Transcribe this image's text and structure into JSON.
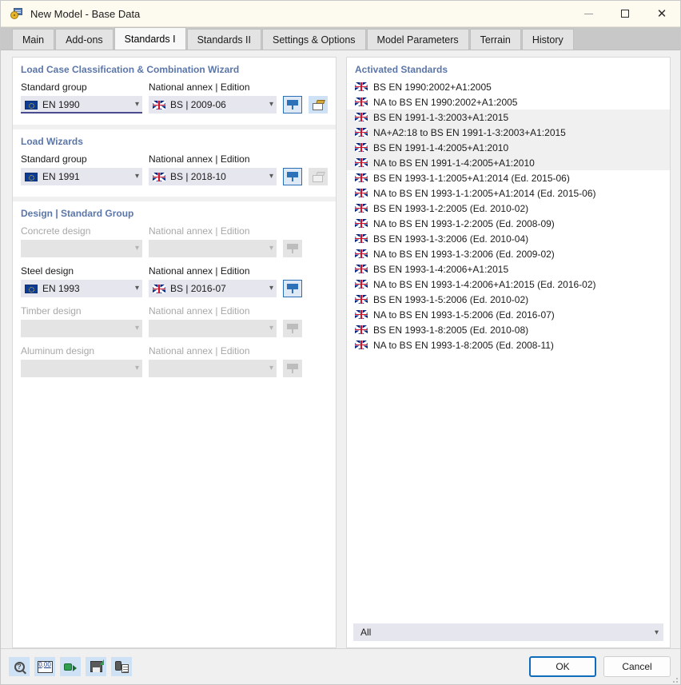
{
  "window": {
    "title": "New Model - Base Data",
    "icon": "model-base-data-icon",
    "minimize": "minimize-icon",
    "maximize": "maximize-icon",
    "close": "close-icon"
  },
  "tabs": [
    {
      "label": "Main",
      "active": false
    },
    {
      "label": "Add-ons",
      "active": false
    },
    {
      "label": "Standards I",
      "active": true
    },
    {
      "label": "Standards II",
      "active": false
    },
    {
      "label": "Settings & Options",
      "active": false
    },
    {
      "label": "Model Parameters",
      "active": false
    },
    {
      "label": "Terrain",
      "active": false
    },
    {
      "label": "History",
      "active": false
    }
  ],
  "groups": [
    {
      "title": "Load Case Classification & Combination Wizard",
      "standard_label": "Standard group",
      "standard_value": "EN 1990",
      "standard_flag": "flag-eu",
      "standard_disabled": false,
      "standard_focused": true,
      "annex_label": "National annex | Edition",
      "annex_value": "BS | 2009-06",
      "annex_flag": "flag-uk",
      "annex_disabled": false,
      "filter_enabled": true,
      "box_enabled": true
    },
    {
      "title": "Load Wizards",
      "standard_label": "Standard group",
      "standard_value": "EN 1991",
      "standard_flag": "flag-eu",
      "standard_disabled": false,
      "standard_focused": false,
      "annex_label": "National annex | Edition",
      "annex_value": "BS | 2018-10",
      "annex_flag": "flag-uk",
      "annex_disabled": false,
      "filter_enabled": true,
      "box_enabled": false
    }
  ],
  "design_group": {
    "title": "Design | Standard Group",
    "rows": [
      {
        "label": "Concrete design",
        "value": "",
        "flag": "none",
        "disabled": true,
        "annex_label": "National annex | Edition",
        "annex_value": "",
        "annex_flag": "none",
        "annex_disabled": true,
        "filter_enabled": false
      },
      {
        "label": "Steel design",
        "value": "EN 1993",
        "flag": "flag-eu",
        "disabled": false,
        "annex_label": "National annex | Edition",
        "annex_value": "BS | 2016-07",
        "annex_flag": "flag-uk",
        "annex_disabled": false,
        "filter_enabled": true
      },
      {
        "label": "Timber design",
        "value": "",
        "flag": "none",
        "disabled": true,
        "annex_label": "National annex | Edition",
        "annex_value": "",
        "annex_flag": "none",
        "annex_disabled": true,
        "filter_enabled": false
      },
      {
        "label": "Aluminum design",
        "value": "",
        "flag": "none",
        "disabled": true,
        "annex_label": "National annex | Edition",
        "annex_value": "",
        "annex_flag": "none",
        "annex_disabled": true,
        "filter_enabled": false
      }
    ]
  },
  "activated_standards": {
    "title": "Activated Standards",
    "items": [
      {
        "label": "BS EN 1990:2002+A1:2005",
        "flag": "flag-uk",
        "highlighted": false
      },
      {
        "label": "NA to BS EN 1990:2002+A1:2005",
        "flag": "flag-uk",
        "highlighted": false
      },
      {
        "label": "BS EN 1991-1-3:2003+A1:2015",
        "flag": "flag-uk",
        "highlighted": true
      },
      {
        "label": "NA+A2:18 to BS EN 1991-1-3:2003+A1:2015",
        "flag": "flag-uk",
        "highlighted": true
      },
      {
        "label": "BS EN 1991-1-4:2005+A1:2010",
        "flag": "flag-uk",
        "highlighted": true
      },
      {
        "label": "NA to BS EN 1991-1-4:2005+A1:2010",
        "flag": "flag-uk",
        "highlighted": true
      },
      {
        "label": "BS EN 1993-1-1:2005+A1:2014 (Ed. 2015-06)",
        "flag": "flag-uk",
        "highlighted": false
      },
      {
        "label": "NA to BS EN 1993-1-1:2005+A1:2014 (Ed. 2015-06)",
        "flag": "flag-uk",
        "highlighted": false
      },
      {
        "label": "BS EN 1993-1-2:2005 (Ed. 2010-02)",
        "flag": "flag-uk",
        "highlighted": false
      },
      {
        "label": "NA to BS EN 1993-1-2:2005 (Ed. 2008-09)",
        "flag": "flag-uk",
        "highlighted": false
      },
      {
        "label": "BS EN 1993-1-3:2006 (Ed. 2010-04)",
        "flag": "flag-uk",
        "highlighted": false
      },
      {
        "label": "NA to BS EN 1993-1-3:2006 (Ed. 2009-02)",
        "flag": "flag-uk",
        "highlighted": false
      },
      {
        "label": "BS EN 1993-1-4:2006+A1:2015",
        "flag": "flag-uk",
        "highlighted": false
      },
      {
        "label": "NA to BS EN 1993-1-4:2006+A1:2015 (Ed. 2016-02)",
        "flag": "flag-uk",
        "highlighted": false
      },
      {
        "label": "BS EN 1993-1-5:2006 (Ed. 2010-02)",
        "flag": "flag-uk",
        "highlighted": false
      },
      {
        "label": "NA to BS EN 1993-1-5:2006 (Ed. 2016-07)",
        "flag": "flag-uk",
        "highlighted": false
      },
      {
        "label": "BS EN 1993-1-8:2005 (Ed. 2010-08)",
        "flag": "flag-uk",
        "highlighted": false
      },
      {
        "label": "NA to BS EN 1993-1-8:2005 (Ed. 2008-11)",
        "flag": "flag-uk",
        "highlighted": false
      }
    ],
    "filter_value": "All"
  },
  "footer": {
    "tools": [
      {
        "name": "help-magnifier-icon"
      },
      {
        "name": "units-decimal-places-icon"
      },
      {
        "name": "import-plugin-icon"
      },
      {
        "name": "save-as-default-icon"
      },
      {
        "name": "copy-from-model-icon"
      }
    ],
    "ok_label": "OK",
    "cancel_label": "Cancel"
  },
  "colors": {
    "accent_blue": "#0f6cbd",
    "group_title": "#5b76a8",
    "combo_bg": "#e6e6ef",
    "focus_underline": "#4a4a8f",
    "titlebar_bg": "#fdfbf0"
  }
}
